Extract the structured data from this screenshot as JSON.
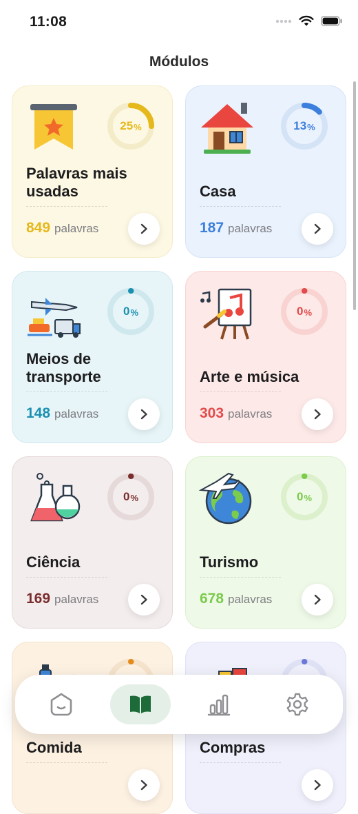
{
  "status": {
    "time": "11:08"
  },
  "header": {
    "title": "Módulos"
  },
  "modules": [
    {
      "title": "Palavras mais usadas",
      "progress_label": "25",
      "progress": 0.25,
      "count": "849",
      "unit": "palavras",
      "accent": "#e5b81b",
      "bg": "#fdf8e3",
      "ring_track": "#f4ecc9",
      "icon": "bookmark-star-icon"
    },
    {
      "title": "Casa",
      "progress_label": "13",
      "progress": 0.13,
      "count": "187",
      "unit": "palavras",
      "accent": "#3d7fdc",
      "bg": "#eaf2fd",
      "ring_track": "#d5e3f7",
      "icon": "house-icon"
    },
    {
      "title": "Meios de transporte",
      "progress_label": "0",
      "progress": 0,
      "count": "148",
      "unit": "palavras",
      "accent": "#1b8fb0",
      "bg": "#e7f5f8",
      "ring_track": "#cfe8ee",
      "icon": "transport-icon"
    },
    {
      "title": "Arte e música",
      "progress_label": "0",
      "progress": 0,
      "count": "303",
      "unit": "palavras",
      "accent": "#e14b4b",
      "bg": "#fde9e8",
      "ring_track": "#f8d3d1",
      "icon": "art-music-icon"
    },
    {
      "title": "Ciência",
      "progress_label": "0",
      "progress": 0,
      "count": "169",
      "unit": "palavras",
      "accent": "#7a2d2d",
      "bg": "#f4eded",
      "ring_track": "#e6d9d9",
      "icon": "lab-flask-icon"
    },
    {
      "title": "Turismo",
      "progress_label": "0",
      "progress": 0,
      "count": "678",
      "unit": "palavras",
      "accent": "#7bcb4c",
      "bg": "#eff9e8",
      "ring_track": "#dcf0cc",
      "icon": "globe-plane-icon"
    },
    {
      "title": "Comida",
      "progress_label": "0",
      "progress": 0,
      "count": "",
      "unit": "",
      "accent": "#e58a1b",
      "bg": "#fdf1e2",
      "ring_track": "#f5e3cc",
      "icon": "food-icon"
    },
    {
      "title": "Compras",
      "progress_label": "0",
      "progress": 0,
      "count": "",
      "unit": "",
      "accent": "#6a78d8",
      "bg": "#eff0fb",
      "ring_track": "#dfe1f5",
      "icon": "shopping-cart-icon"
    }
  ],
  "nav": {
    "active_color": "#1e6b3a",
    "items": [
      {
        "name": "home",
        "icon": "home-face-icon"
      },
      {
        "name": "modules",
        "icon": "book-icon",
        "active": true
      },
      {
        "name": "stats",
        "icon": "bar-chart-icon"
      },
      {
        "name": "settings",
        "icon": "gear-icon"
      }
    ]
  }
}
